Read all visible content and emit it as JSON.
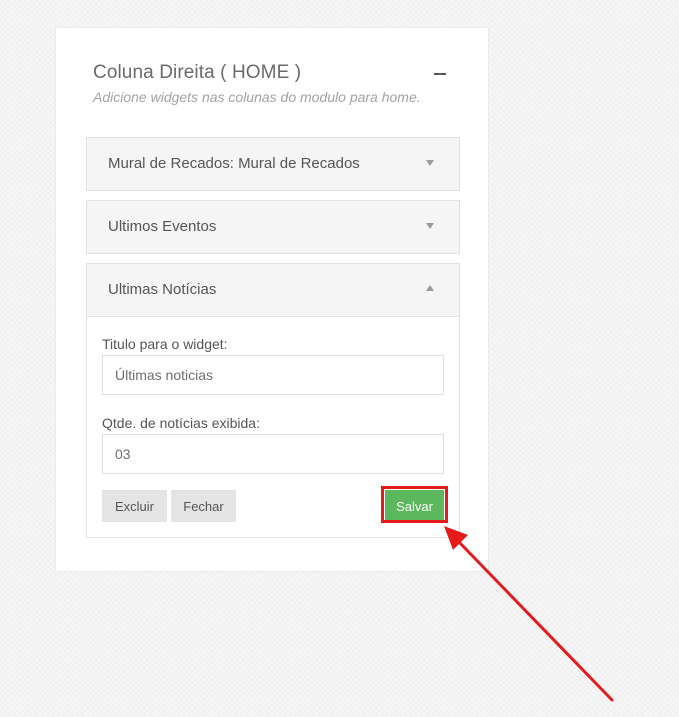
{
  "widget_card": {
    "title": "Coluna Direita ( HOME )",
    "subtitle": "Adicione widgets nas colunas do modulo para home.",
    "collapse_icon": "minus-icon"
  },
  "panels": [
    {
      "title": "Mural de Recados: Mural de Recados",
      "state": "collapsed",
      "caret": "caret-down-icon"
    },
    {
      "title": "Ultimos Eventos",
      "state": "collapsed",
      "caret": "caret-down-icon"
    },
    {
      "title": "Ultimas Notícias",
      "state": "expanded",
      "caret": "caret-up-icon"
    }
  ],
  "form": {
    "title_label": "Titulo para o widget:",
    "title_value": "Últimas noticias",
    "count_label": "Qtde. de notícias exibida:",
    "count_value": "03"
  },
  "buttons": {
    "delete": "Excluir",
    "close": "Fechar",
    "save": "Salvar"
  },
  "annotation": {
    "highlight_color": "#e51a1a",
    "accent_green": "#5cb85c"
  }
}
